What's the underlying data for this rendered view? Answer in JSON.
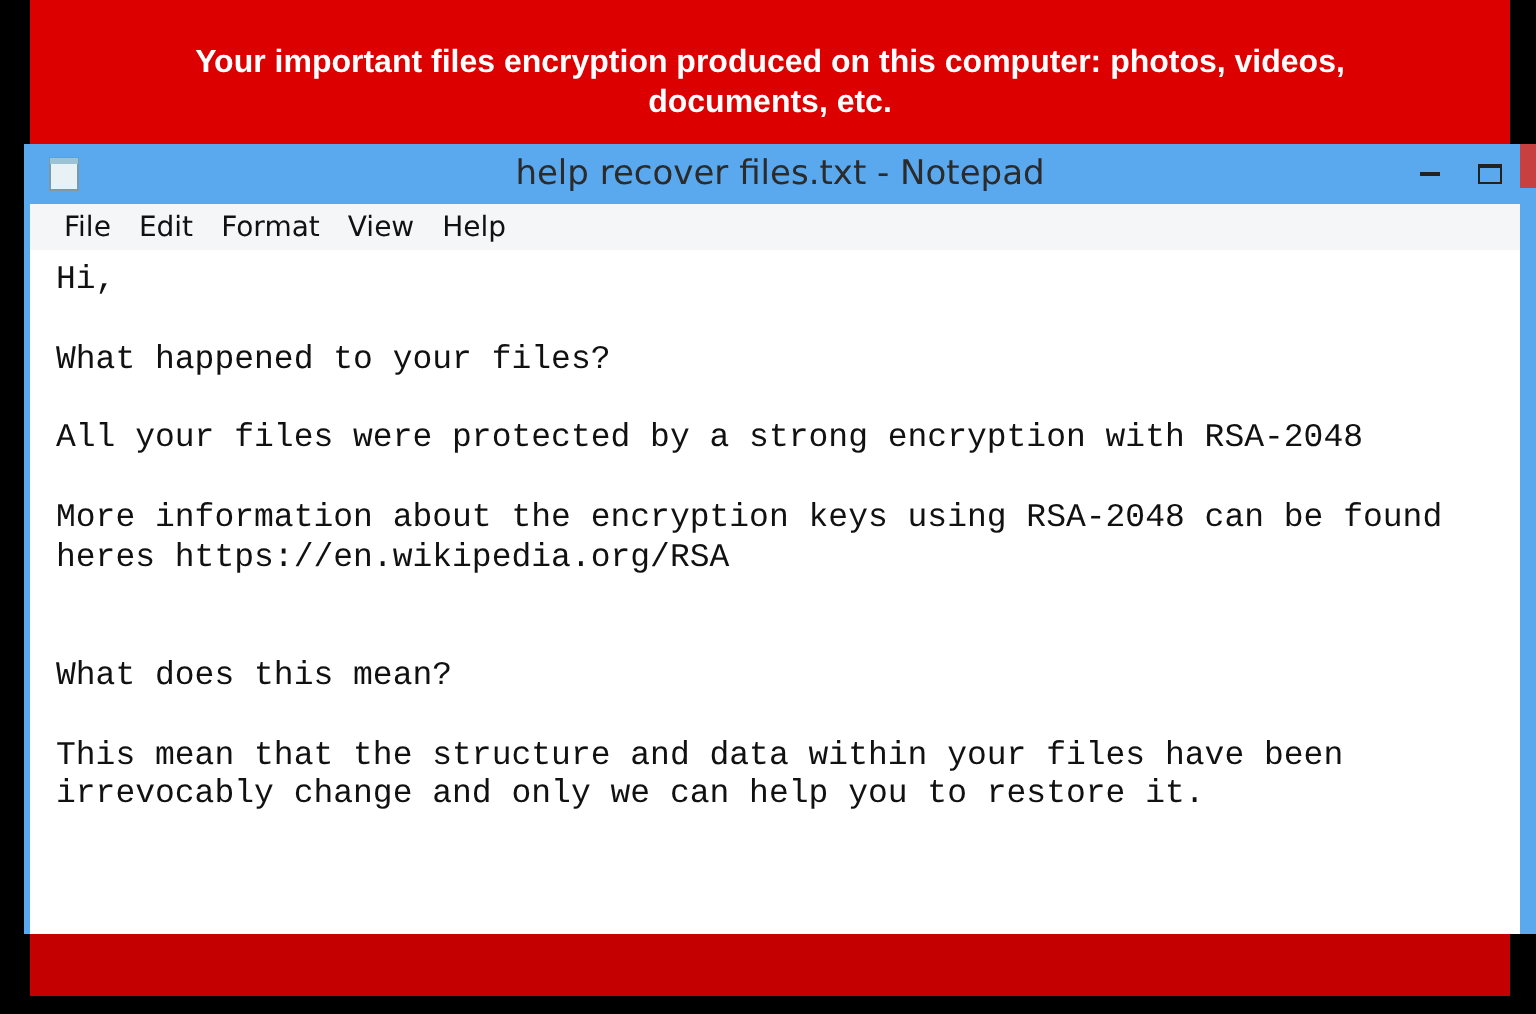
{
  "banner": {
    "message": "Your important files encryption produced on this computer: photos, videos, documents, etc."
  },
  "window": {
    "title": "help recover files.txt - Notepad"
  },
  "menu": [
    "File",
    "Edit",
    "Format",
    "View",
    "Help"
  ],
  "document": {
    "text": "Hi,\n\nWhat happened to your files?\n\nAll your files were protected by a strong encryption with RSA-2048\n\nMore information about the encryption keys using RSA-2048 can be found\nheres https://en.wikipedia.org/RSA\n\n\nWhat does this mean?\n\nThis mean that the structure and data within your files have been\nirrevocably change and only we can help you to restore it."
  }
}
